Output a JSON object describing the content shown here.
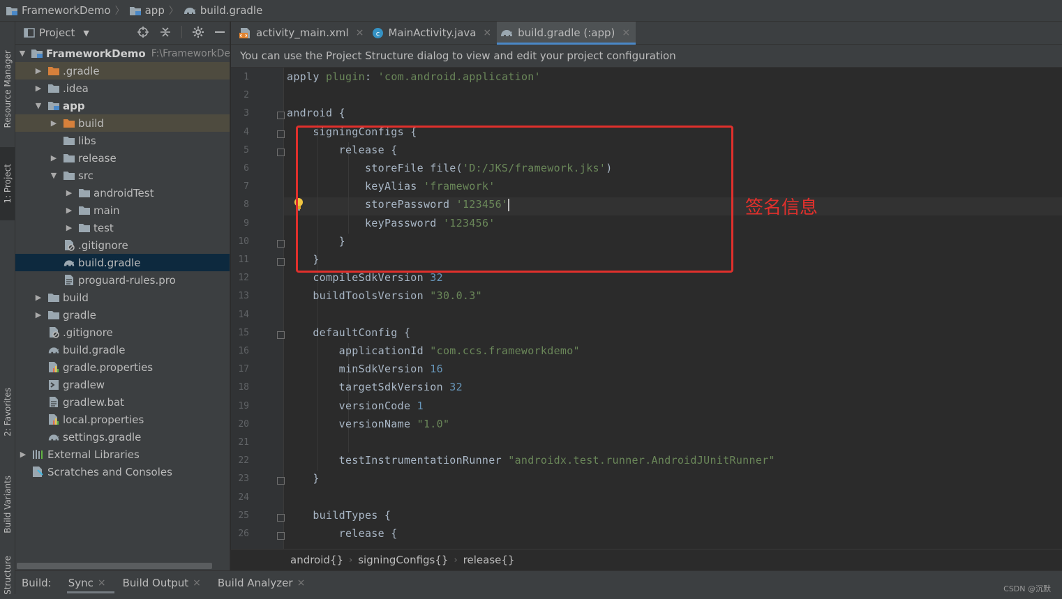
{
  "navbar": {
    "project": "FrameworkDemo",
    "module": "app",
    "file": "build.gradle"
  },
  "left_strip": {
    "resource_manager": "Resource Manager",
    "project": "1: Project",
    "favorites": "2: Favorites",
    "build_variants": "Build Variants",
    "structure": "Structure"
  },
  "project_panel": {
    "title": "Project",
    "tree": [
      {
        "label": "FrameworkDemo",
        "path": "F:\\FrameworkDe",
        "depth": 0,
        "arrow": "down",
        "icon": "module-folder-icon",
        "bold": true
      },
      {
        "label": ".gradle",
        "depth": 1,
        "arrow": "right",
        "icon": "excluded-folder-icon",
        "excluded": true
      },
      {
        "label": ".idea",
        "depth": 1,
        "arrow": "right",
        "icon": "folder-icon"
      },
      {
        "label": "app",
        "depth": 1,
        "arrow": "down",
        "icon": "module-folder-icon",
        "bold": true
      },
      {
        "label": "build",
        "depth": 2,
        "arrow": "right",
        "icon": "excluded-folder-icon",
        "excluded": true
      },
      {
        "label": "libs",
        "depth": 2,
        "arrow": "none",
        "icon": "folder-icon"
      },
      {
        "label": "release",
        "depth": 2,
        "arrow": "right",
        "icon": "folder-icon"
      },
      {
        "label": "src",
        "depth": 2,
        "arrow": "down",
        "icon": "folder-icon"
      },
      {
        "label": "androidTest",
        "depth": 3,
        "arrow": "right",
        "icon": "folder-icon"
      },
      {
        "label": "main",
        "depth": 3,
        "arrow": "right",
        "icon": "folder-icon"
      },
      {
        "label": "test",
        "depth": 3,
        "arrow": "right",
        "icon": "folder-icon"
      },
      {
        "label": ".gitignore",
        "depth": 2,
        "arrow": "none",
        "icon": "ignore-file-icon"
      },
      {
        "label": "build.gradle",
        "depth": 2,
        "arrow": "none",
        "icon": "gradle-elephant-icon",
        "selected": true
      },
      {
        "label": "proguard-rules.pro",
        "depth": 2,
        "arrow": "none",
        "icon": "text-file-icon"
      },
      {
        "label": "build",
        "depth": 1,
        "arrow": "right",
        "icon": "folder-icon"
      },
      {
        "label": "gradle",
        "depth": 1,
        "arrow": "right",
        "icon": "folder-icon"
      },
      {
        "label": ".gitignore",
        "depth": 1,
        "arrow": "none",
        "icon": "ignore-file-icon"
      },
      {
        "label": "build.gradle",
        "depth": 1,
        "arrow": "none",
        "icon": "gradle-elephant-icon"
      },
      {
        "label": "gradle.properties",
        "depth": 1,
        "arrow": "none",
        "icon": "properties-file-icon"
      },
      {
        "label": "gradlew",
        "depth": 1,
        "arrow": "none",
        "icon": "shell-script-icon"
      },
      {
        "label": "gradlew.bat",
        "depth": 1,
        "arrow": "none",
        "icon": "text-file-icon"
      },
      {
        "label": "local.properties",
        "depth": 1,
        "arrow": "none",
        "icon": "properties-file-icon"
      },
      {
        "label": "settings.gradle",
        "depth": 1,
        "arrow": "none",
        "icon": "gradle-elephant-icon"
      },
      {
        "label": "External Libraries",
        "depth": 0,
        "arrow": "right",
        "icon": "libraries-icon"
      },
      {
        "label": "Scratches and Consoles",
        "depth": 0,
        "arrow": "none",
        "icon": "scratches-icon"
      }
    ]
  },
  "editor_tabs": [
    {
      "label": "activity_main.xml",
      "icon": "xml-file-icon",
      "active": false
    },
    {
      "label": "MainActivity.java",
      "icon": "java-class-icon",
      "active": false
    },
    {
      "label": "build.gradle (:app)",
      "icon": "gradle-elephant-icon",
      "active": true
    }
  ],
  "banner": {
    "message": "You can use the Project Structure dialog to view and edit your project configuration"
  },
  "editor": {
    "line_numbers": [
      "1",
      "2",
      "3",
      "4",
      "5",
      "6",
      "7",
      "8",
      "9",
      "10",
      "11",
      "12",
      "13",
      "14",
      "15",
      "16",
      "17",
      "18",
      "19",
      "20",
      "21",
      "22",
      "23",
      "24",
      "25",
      "26"
    ],
    "lines": [
      [
        {
          "t": "apply ",
          "c": ""
        },
        {
          "t": "plugin",
          "c": "str"
        },
        {
          "t": ": ",
          "c": ""
        },
        {
          "t": "'com.android.application'",
          "c": "str"
        }
      ],
      [],
      [
        {
          "t": "android {",
          "c": ""
        }
      ],
      [
        {
          "t": "    signingConfigs {",
          "c": ""
        }
      ],
      [
        {
          "t": "        release {",
          "c": ""
        }
      ],
      [
        {
          "t": "            storeFile file(",
          "c": ""
        },
        {
          "t": "'D:/JKS/framework.jks'",
          "c": "str"
        },
        {
          "t": ")",
          "c": ""
        }
      ],
      [
        {
          "t": "            keyAlias ",
          "c": ""
        },
        {
          "t": "'framework'",
          "c": "str"
        }
      ],
      [
        {
          "t": "            storePassword ",
          "c": ""
        },
        {
          "t": "'123456'",
          "c": "str"
        }
      ],
      [
        {
          "t": "            keyPassword ",
          "c": ""
        },
        {
          "t": "'123456'",
          "c": "str"
        }
      ],
      [
        {
          "t": "        }",
          "c": ""
        }
      ],
      [
        {
          "t": "    }",
          "c": ""
        }
      ],
      [
        {
          "t": "    compileSdkVersion ",
          "c": ""
        },
        {
          "t": "32",
          "c": "num"
        }
      ],
      [
        {
          "t": "    buildToolsVersion ",
          "c": ""
        },
        {
          "t": "\"30.0.3\"",
          "c": "str"
        }
      ],
      [],
      [
        {
          "t": "    defaultConfig {",
          "c": ""
        }
      ],
      [
        {
          "t": "        applicationId ",
          "c": ""
        },
        {
          "t": "\"com.ccs.frameworkdemo\"",
          "c": "str"
        }
      ],
      [
        {
          "t": "        minSdkVersion ",
          "c": ""
        },
        {
          "t": "16",
          "c": "num"
        }
      ],
      [
        {
          "t": "        targetSdkVersion ",
          "c": ""
        },
        {
          "t": "32",
          "c": "num"
        }
      ],
      [
        {
          "t": "        versionCode ",
          "c": ""
        },
        {
          "t": "1",
          "c": "num"
        }
      ],
      [
        {
          "t": "        versionName ",
          "c": ""
        },
        {
          "t": "\"1.0\"",
          "c": "str"
        }
      ],
      [],
      [
        {
          "t": "        testInstrumentationRunner ",
          "c": ""
        },
        {
          "t": "\"androidx.test.runner.AndroidJUnitRunner\"",
          "c": "str"
        }
      ],
      [
        {
          "t": "    }",
          "c": ""
        }
      ],
      [],
      [
        {
          "t": "    buildTypes {",
          "c": ""
        }
      ],
      [
        {
          "t": "        release {",
          "c": ""
        }
      ]
    ]
  },
  "annotation": {
    "label": "签名信息",
    "color": "#e0302c"
  },
  "breadcrumb": [
    "android{}",
    "signingConfigs{}",
    "release{}"
  ],
  "build_bar": {
    "prefix": "Build:",
    "tabs": [
      {
        "label": "Sync",
        "active": true
      },
      {
        "label": "Build Output",
        "active": false
      },
      {
        "label": "Build Analyzer",
        "active": false
      }
    ]
  },
  "watermark": "CSDN @沉默",
  "colors": {
    "accent": "#4a88c7",
    "string": "#6a8759",
    "number": "#6897bb",
    "folder": "#9aa7b0",
    "excluded_folder": "#d6803b"
  }
}
